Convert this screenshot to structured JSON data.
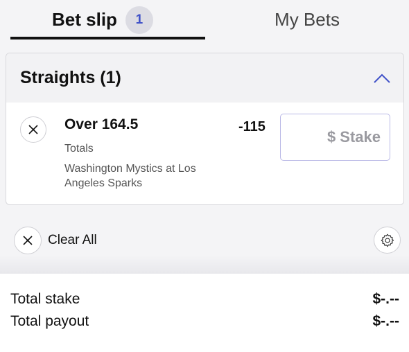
{
  "tabs": {
    "bet_slip_label": "Bet slip",
    "bet_slip_count": "1",
    "my_bets_label": "My Bets"
  },
  "section": {
    "title": "Straights (1)"
  },
  "bet": {
    "selection": "Over 164.5",
    "market": "Totals",
    "event": "Washington Mystics at Los Angeles Sparks",
    "odds": "-115",
    "stake_placeholder": "$ Stake",
    "stake_value": ""
  },
  "actions": {
    "clear_all_label": "Clear All"
  },
  "totals": {
    "stake_label": "Total stake",
    "stake_value": "$-.--",
    "payout_label": "Total payout",
    "payout_value": "$-.--"
  },
  "colors": {
    "accent": "#3f51c8",
    "badge_bg": "#dcdce3",
    "stake_border": "#b9b8e6"
  },
  "icons": [
    "close-icon",
    "chevron-up-icon",
    "gear-icon"
  ]
}
